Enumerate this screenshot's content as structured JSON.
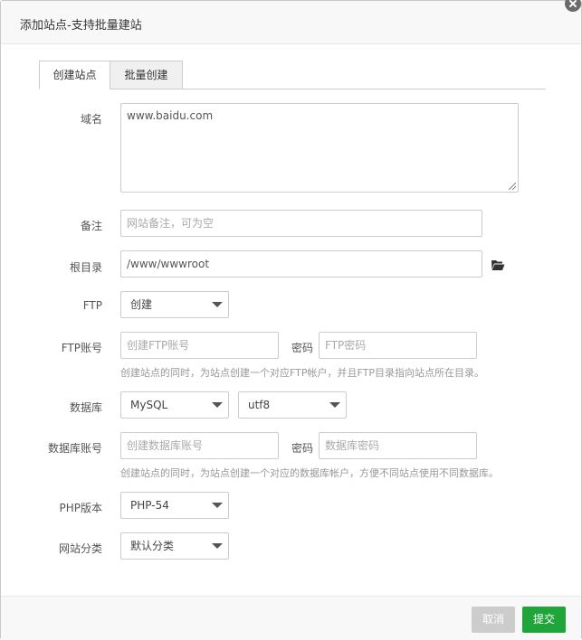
{
  "dialog": {
    "title": "添加站点-支持批量建站"
  },
  "tabs": [
    {
      "label": "创建站点",
      "active": true
    },
    {
      "label": "批量创建",
      "active": false
    }
  ],
  "form": {
    "domain": {
      "label": "域名",
      "value": "www.baidu.com"
    },
    "remark": {
      "label": "备注",
      "placeholder": "网站备注，可为空"
    },
    "root_dir": {
      "label": "根目录",
      "value": "/www/wwwroot",
      "icon": "folder-open-icon"
    },
    "ftp": {
      "label": "FTP",
      "selected": "创建"
    },
    "ftp_account": {
      "label": "FTP账号",
      "user_placeholder": "创建FTP账号",
      "password_label": "密码",
      "password_placeholder": "FTP密码",
      "hint": "创建站点的同时，为站点创建一个对应FTP帐户，并且FTP目录指向站点所在目录。"
    },
    "database": {
      "label": "数据库",
      "type_selected": "MySQL",
      "charset_selected": "utf8"
    },
    "db_account": {
      "label": "数据库账号",
      "user_placeholder": "创建数据库账号",
      "password_label": "密码",
      "password_placeholder": "数据库密码",
      "hint": "创建站点的同时，为站点创建一个对应的数据库帐户，方便不同站点使用不同数据库。"
    },
    "php_version": {
      "label": "PHP版本",
      "selected": "PHP-54"
    },
    "site_category": {
      "label": "网站分类",
      "selected": "默认分类"
    }
  },
  "footer": {
    "cancel_label": "取消",
    "submit_label": "提交"
  },
  "colors": {
    "submit": "#20a53a",
    "cancel": "#cccccc"
  }
}
